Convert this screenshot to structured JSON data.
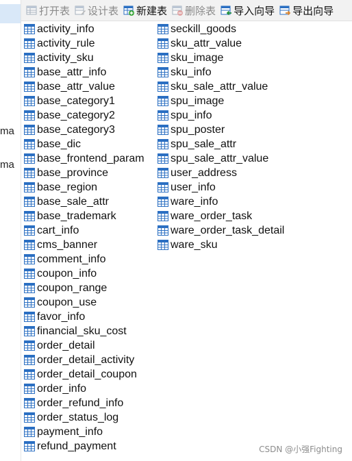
{
  "toolbar": {
    "open_table": "打开表",
    "design_table": "设计表",
    "new_table": "新建表",
    "delete_table": "删除表",
    "import_wizard": "导入向导",
    "export_wizard": "导出向导"
  },
  "left_panel": {
    "fragment_1": "ma",
    "fragment_2": "ma"
  },
  "tables_col1": [
    "activity_info",
    "activity_rule",
    "activity_sku",
    "base_attr_info",
    "base_attr_value",
    "base_category1",
    "base_category2",
    "base_category3",
    "base_dic",
    "base_frontend_param",
    "base_province",
    "base_region",
    "base_sale_attr",
    "base_trademark",
    "cart_info",
    "cms_banner",
    "comment_info",
    "coupon_info",
    "coupon_range",
    "coupon_use",
    "favor_info",
    "financial_sku_cost",
    "order_detail",
    "order_detail_activity",
    "order_detail_coupon",
    "order_info",
    "order_refund_info",
    "order_status_log",
    "payment_info",
    "refund_payment"
  ],
  "tables_col2": [
    "seckill_goods",
    "sku_attr_value",
    "sku_image",
    "sku_info",
    "sku_sale_attr_value",
    "spu_image",
    "spu_info",
    "spu_poster",
    "spu_sale_attr",
    "spu_sale_attr_value",
    "user_address",
    "user_info",
    "ware_info",
    "ware_order_task",
    "ware_order_task_detail",
    "ware_sku"
  ],
  "watermark": "CSDN @小强Fighting",
  "colors": {
    "table_icon_blue": "#2b6fc2",
    "toolbar_bg": "#f2f2f2",
    "selection": "#d9e8f8"
  },
  "icons": {
    "table": "table-grid-icon",
    "open": "open-table-icon",
    "design": "design-table-icon",
    "new": "new-table-icon",
    "delete": "delete-table-icon",
    "import": "import-wizard-icon",
    "export": "export-wizard-icon"
  }
}
